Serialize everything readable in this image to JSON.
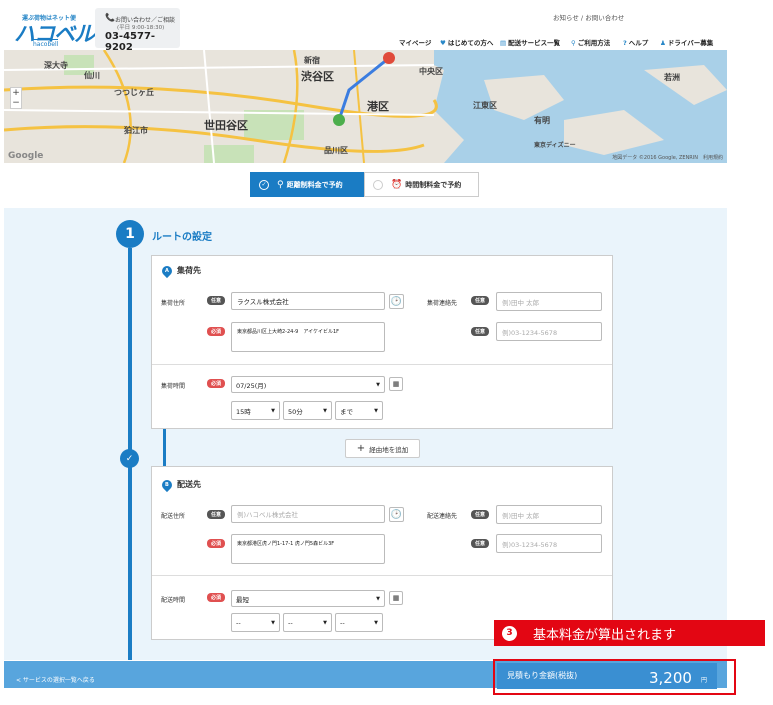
{
  "header": {
    "logo_tagline": "運ぶ荷物はネット便",
    "logo_text": "ハコベル",
    "logo_sub": "hacobell",
    "contact_label": "お問い合わせ／ご相談",
    "contact_hours": "(平日 9:00-18:30)",
    "contact_phone": "03-4577-9202",
    "top_links": "お知らせ / お問い合わせ",
    "nav": [
      {
        "label": "マイページ",
        "icon": "none"
      },
      {
        "label": "はじめての方へ",
        "icon": "beginner-icon"
      },
      {
        "label": "配送サービス一覧",
        "icon": "list-icon"
      },
      {
        "label": "ご利用方法",
        "icon": "search-icon"
      },
      {
        "label": "ヘルプ",
        "icon": "help-icon"
      },
      {
        "label": "ドライバー募集",
        "icon": "person-icon"
      }
    ]
  },
  "map": {
    "labels": [
      "渋谷区",
      "港区",
      "世田谷区",
      "中央区",
      "江東区",
      "狛江市",
      "深大寺",
      "仙川",
      "つつじヶ丘",
      "新宿",
      "東京ディズニー",
      "若洲",
      "有明",
      "品川区"
    ],
    "zoom_in": "+",
    "zoom_out": "−",
    "google": "Google",
    "copyright": "地図データ ©2016 Google, ZENRIN　利用規約"
  },
  "tabs": {
    "distance": "距離制料金で予約",
    "time": "時間制料金で予約"
  },
  "route": {
    "step_number": "1",
    "title": "ルートの設定"
  },
  "pickup": {
    "marker": "A",
    "title": "集荷先",
    "address_label": "集荷住所",
    "optional_badge": "任意",
    "required_badge": "必須",
    "name_value": "ラクスル株式会社",
    "address_value": "東京都品川区上大崎2-24-9　アイケイビル1F",
    "contact_label": "集荷連絡先",
    "contact_name_placeholder": "例)田中 太郎",
    "contact_phone_placeholder": "例)03-1234-5678",
    "time_label": "集荷時間",
    "date_value": "07/25(月)",
    "hour_value": "15時",
    "minute_value": "50分",
    "until_value": "まで"
  },
  "add_via": {
    "plus": "+",
    "label": "経由地を追加"
  },
  "delivery": {
    "marker": "B",
    "title": "配送先",
    "address_label": "配送住所",
    "optional_badge": "任意",
    "required_badge": "必須",
    "name_placeholder": "例)ハコベル株式会社",
    "address_value": "東京都港区虎ノ門1-17-1 虎ノ門5森ビル3F",
    "contact_label": "配送連絡先",
    "contact_name_placeholder": "例)田中 太郎",
    "contact_phone_placeholder": "例)03-1234-5678",
    "time_label": "配送時間",
    "date_value": "最短",
    "hour_value": "--",
    "minute_value": "--",
    "until_value": "--"
  },
  "footer": {
    "back_link": "< サービスの選択一覧へ戻る",
    "estimate_label": "見積もり金額(税抜)",
    "estimate_value": "3,200",
    "currency": "円"
  },
  "callout": {
    "number": "3",
    "text": "基本料金が算出されます"
  },
  "colors": {
    "primary": "#1a7cc4",
    "required": "#e05050",
    "callout": "#e30613",
    "panel": "#eaf4fb"
  }
}
